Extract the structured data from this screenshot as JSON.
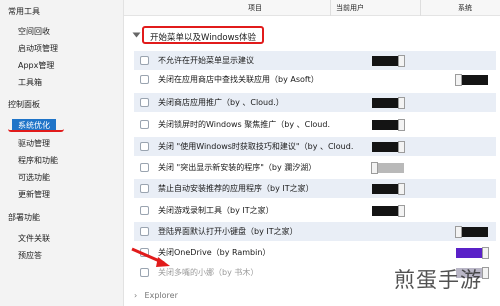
{
  "sidebar": {
    "groups": [
      {
        "label": "常用工具",
        "items": [
          "空间回收",
          "启动项管理",
          "Appx管理",
          "工具箱"
        ]
      },
      {
        "label": "控制面板",
        "items": [
          "系统优化",
          "驱动管理",
          "程序和功能",
          "可选功能",
          "更新管理"
        ]
      },
      {
        "label": "部署功能",
        "items": [
          "文件关联",
          "预应答"
        ]
      }
    ],
    "selected": "系统优化"
  },
  "columns": {
    "item": "项目",
    "current_user": "当前用户",
    "system": "系统"
  },
  "section_title": "开始菜单以及Windows体验",
  "rows": [
    {
      "label": "不允许在开始菜单显示建议",
      "user": "on",
      "system": null
    },
    {
      "label": "关闭在应用商店中查找关联应用（by Asoft）",
      "user": null,
      "system": "off"
    },
    {
      "label": "关闭商店应用推广（by 、Cloud.）",
      "user": "on",
      "system": null
    },
    {
      "label": "关闭锁屏时的Windows 聚焦推广（by 、Cloud.",
      "user": "on",
      "system": null
    },
    {
      "label": "关闭 \"使用Windows时获取技巧和建议\"（by 、Cloud.",
      "user": "on",
      "system": null
    },
    {
      "label": "关闭 \"突出显示新安装的程序\"（by 瀾汐湖）",
      "user": "off-dim",
      "system": null
    },
    {
      "label": "禁止自动安装推荐的应用程序（by IT之家）",
      "user": "on",
      "system": null
    },
    {
      "label": "关闭游戏录制工具（by IT之家）",
      "user": "on",
      "system": null
    },
    {
      "label": "登陆界面默认打开小键盘（by IT之家）",
      "user": null,
      "system": "off"
    },
    {
      "label": "关闭OneDrive（by Rambin）",
      "user": null,
      "system": "on-purple"
    },
    {
      "label": "关闭多嘴的小娜（by 书木）",
      "user": null,
      "system": "on-light"
    }
  ],
  "explorer_label": "Explorer",
  "watermark": "煎蛋手游"
}
